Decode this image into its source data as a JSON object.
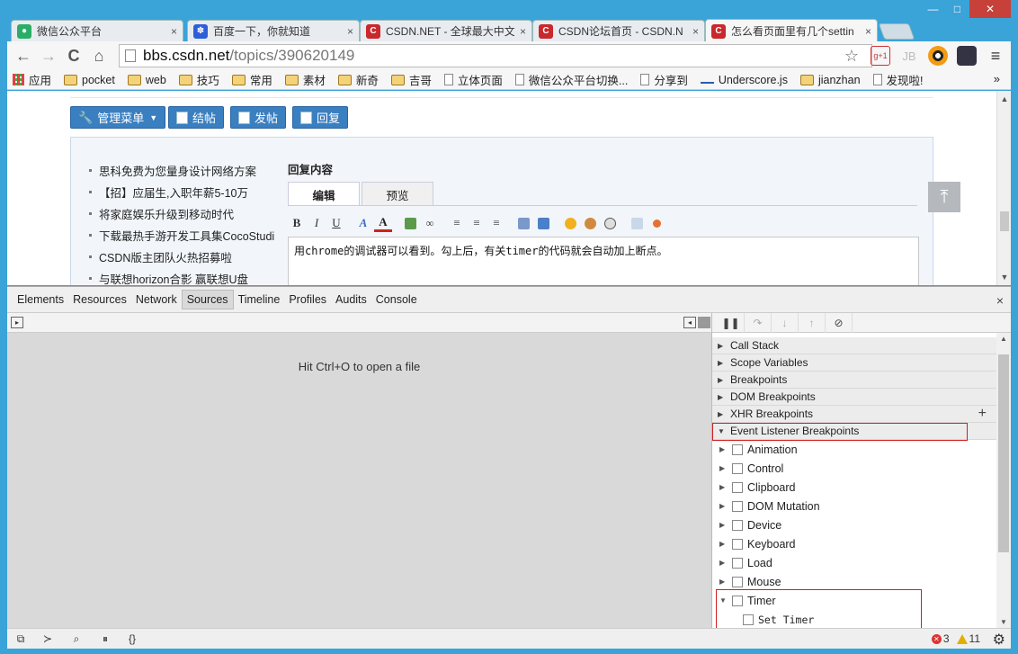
{
  "browser": {
    "tabs": [
      {
        "title": "微信公众平台",
        "favicon_color": "#2aae67",
        "favicon_glyph": "●"
      },
      {
        "title": "百度一下，你就知道",
        "favicon_color": "#2d5fd8",
        "favicon_glyph": "✽"
      },
      {
        "title": "CSDN.NET - 全球最大中文",
        "favicon_color": "#c9282d",
        "favicon_glyph": "C"
      },
      {
        "title": "CSDN论坛首页 - CSDN.N",
        "favicon_color": "#c9282d",
        "favicon_glyph": "C"
      },
      {
        "title": "怎么看页面里有几个settin",
        "favicon_color": "#c9282d",
        "favicon_glyph": "C"
      }
    ],
    "tab_close_glyph": "×",
    "window_buttons": {
      "minimize": "—",
      "maximize": "□",
      "close": "✕"
    },
    "url": {
      "host": "bbs.csdn.net",
      "path": "/topics/390620149"
    },
    "nav": {
      "back": "←",
      "forward": "→",
      "reload": "C",
      "home": "⌂"
    },
    "extensions": {
      "star": "☆",
      "gplus": "g+1",
      "jb": "JB",
      "menu": "≡"
    },
    "bookmarks": [
      {
        "label": "应用",
        "icon": "apps-icon"
      },
      {
        "label": "pocket",
        "icon": "folder-icon"
      },
      {
        "label": "web",
        "icon": "folder-icon"
      },
      {
        "label": "技巧",
        "icon": "folder-icon"
      },
      {
        "label": "常用",
        "icon": "folder-icon"
      },
      {
        "label": "素材",
        "icon": "folder-icon"
      },
      {
        "label": "新奇",
        "icon": "folder-icon"
      },
      {
        "label": "吉哥",
        "icon": "folder-icon"
      },
      {
        "label": "立体页面",
        "icon": "page-icon"
      },
      {
        "label": "微信公众平台切换...",
        "icon": "page-icon"
      },
      {
        "label": "分享到",
        "icon": "page-icon"
      },
      {
        "label": "Underscore.js",
        "icon": "underscore-icon"
      },
      {
        "label": "jianzhan",
        "icon": "folder-icon"
      },
      {
        "label": "发现啦!",
        "icon": "page-icon"
      }
    ],
    "bookmarks_more": "»"
  },
  "page": {
    "actions": {
      "manage": "管理菜单",
      "close_topic": "结帖",
      "post": "发帖",
      "reply": "回复"
    },
    "side_links": [
      "思科免费为您量身设计网络方案",
      "【招】应届生,入职年薪5-10万",
      "将家庭娱乐升级到移动时代",
      "下载最热手游开发工具集CocoStudi",
      "CSDN版主团队火热招募啦",
      "与联想horizon合影 赢联想U盘"
    ],
    "reply_title": "回复内容",
    "editor_tabs": {
      "edit": "编辑",
      "preview": "预览"
    },
    "editor_toolbar": {
      "bold": "B",
      "italic": "I",
      "underline": "U",
      "font_color": "A",
      "bg_color": "A"
    },
    "editor_text": "用chrome的调试器可以看到。勾上后，有关timer的代码就会自动加上断点。",
    "back_to_top": "⤒"
  },
  "devtools": {
    "tabs": [
      "Elements",
      "Resources",
      "Network",
      "Sources",
      "Timeline",
      "Profiles",
      "Audits",
      "Console"
    ],
    "active_tab": "Sources",
    "close": "×",
    "hint": "Hit Ctrl+O to open a file",
    "sections": [
      {
        "label": "Call Stack",
        "expanded": false
      },
      {
        "label": "Scope Variables",
        "expanded": false
      },
      {
        "label": "Breakpoints",
        "expanded": false
      },
      {
        "label": "DOM Breakpoints",
        "expanded": false
      },
      {
        "label": "XHR Breakpoints",
        "expanded": false
      },
      {
        "label": "Event Listener Breakpoints",
        "expanded": true
      }
    ],
    "xhr_add": "+",
    "event_categories": [
      "Animation",
      "Control",
      "Clipboard",
      "DOM Mutation",
      "Device",
      "Keyboard",
      "Load",
      "Mouse",
      "Timer"
    ],
    "timer_children": [
      "Set Timer"
    ],
    "status": {
      "errors": "3",
      "warnings": "11"
    },
    "bottom_icons": {
      "dock": "⧉",
      "console": "≻",
      "search": "⌕",
      "pause": "⏸",
      "pretty": "{}",
      "settings": "⚙"
    }
  }
}
